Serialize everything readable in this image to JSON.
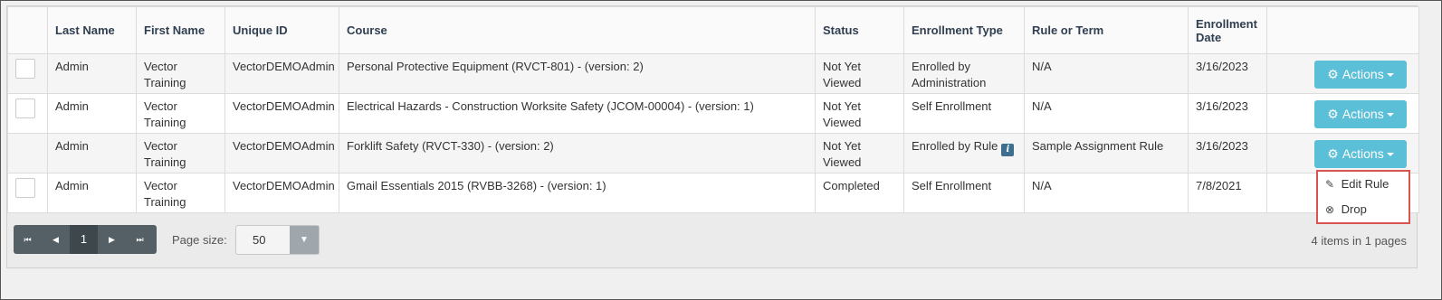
{
  "columns": [
    "",
    "Last Name",
    "First Name",
    "Unique ID",
    "Course",
    "Status",
    "Enrollment Type",
    "Rule or Term",
    "Enrollment Date",
    ""
  ],
  "rows": [
    {
      "last": "Admin",
      "first": "Vector Training",
      "uid": "VectorDEMOAdmin",
      "course": "Personal Protective Equipment (RVCT-801) - (version: 2)",
      "status": "Not Yet Viewed",
      "type": "Enrolled by Administration",
      "rule": "N/A",
      "date": "3/16/2023",
      "action": "Actions"
    },
    {
      "last": "Admin",
      "first": "Vector Training",
      "uid": "VectorDEMOAdmin",
      "course": "Electrical Hazards - Construction Worksite Safety (JCOM-00004) - (version: 1)",
      "status": "Not Yet Viewed",
      "type": "Self Enrollment",
      "rule": "N/A",
      "date": "3/16/2023",
      "action": "Actions"
    },
    {
      "last": "Admin",
      "first": "Vector Training",
      "uid": "VectorDEMOAdmin",
      "course": "Forklift Safety (RVCT-330) - (version: 2)",
      "status": "Not Yet Viewed",
      "type": "Enrolled by Rule",
      "rule": "Sample Assignment Rule",
      "date": "3/16/2023",
      "action": "Actions"
    },
    {
      "last": "Admin",
      "first": "Vector Training",
      "uid": "VectorDEMOAdmin",
      "course": "Gmail Essentials 2015 (RVBB-3268) - (version: 1)",
      "status": "Completed",
      "type": "Self Enrollment",
      "rule": "N/A",
      "date": "7/8/2021",
      "action": ""
    }
  ],
  "dropdown": {
    "edit": "Edit Rule",
    "drop": "Drop"
  },
  "pager": {
    "current": "1",
    "page_size_label": "Page size:",
    "page_size": "50",
    "summary": "4 items in 1 pages"
  },
  "colors": {
    "action_button": "#5bbfd8",
    "highlight_border": "#d9534f",
    "header_text": "#2f3e50"
  },
  "icons": {
    "action": "gear-icon",
    "edit": "pencil-icon",
    "drop": "close-circle-icon",
    "info": "info-icon"
  }
}
